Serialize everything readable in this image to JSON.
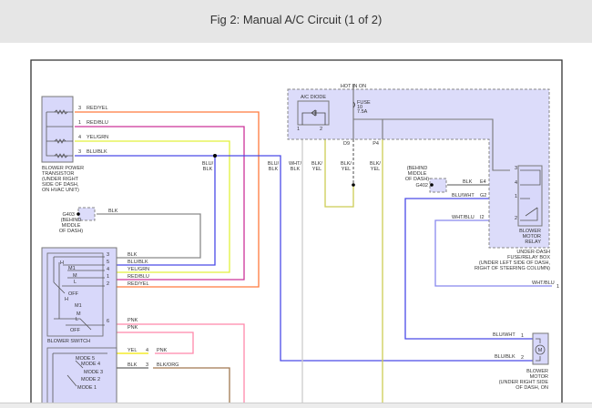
{
  "header": {
    "title": "Fig 2: Manual A/C Circuit (1 of 2)"
  },
  "colors": {
    "red_yel": "#ff7a3d",
    "red_blu": "#cc3399",
    "yel_grn": "#e2f03c",
    "blu": "#4a4ae8",
    "blk": "#8a8a8a",
    "wht": "#cccccc",
    "blk_yel": "#cccc55",
    "pnk": "#ff88aa",
    "brn": "#a07850",
    "yel": "#f2e600"
  },
  "transistor": {
    "label": [
      "BLOWER POWER",
      "TRANSISTOR",
      "(UNDER RIGHT",
      "SIDE OF DASH,",
      "ON HVAC UNIT)"
    ],
    "pins": [
      {
        "n": "3",
        "wire": "RED/YEL"
      },
      {
        "n": "1",
        "wire": "RED/BLU"
      },
      {
        "n": "4",
        "wire": "YEL/GRN"
      },
      {
        "n": "3",
        "wire": "BLU/BLK"
      }
    ]
  },
  "g403": {
    "label": [
      "G403",
      "(BEHIND",
      "MIDDLE",
      "OF DASH)"
    ],
    "wire": "BLK"
  },
  "vertical_labels": [
    [
      "BLU/",
      "BLK"
    ],
    [
      "BLU/",
      "BLK"
    ],
    [
      "WHT/",
      "BLK"
    ],
    [
      "BLK/",
      "YEL"
    ],
    [
      "BLK/",
      "YEL"
    ],
    [
      "BLK/",
      "YEL"
    ]
  ],
  "fusebox": {
    "hot": "HOT IN ON",
    "fuse": [
      "FUSE",
      "10",
      "7.5A"
    ],
    "diode": "A/C DIODE",
    "diode_pins": [
      "1",
      "2"
    ],
    "d9": "D9",
    "p4": "P4",
    "label": [
      "UNDER-DASH",
      "FUSE/RELAY BOX",
      "(UNDER LEFT SIDE OF DASH,",
      "RIGHT OF STEERING COLUMN)"
    ]
  },
  "g402": {
    "label": [
      "(BEHIND",
      "MIDDLE",
      "OF DASH)",
      "G402"
    ],
    "wire": "BLK",
    "pin": "E4"
  },
  "relay": {
    "label": [
      "BLOWER",
      "MOTOR",
      "RELAY"
    ],
    "pins": [
      "3",
      "4",
      "1",
      "2"
    ],
    "wires": [
      {
        "wire": "BLU/WHT",
        "pin": "G2"
      },
      {
        "wire": "WHT/BLU",
        "pin": "I2"
      }
    ]
  },
  "wht_blu_out": {
    "wire": "WHT/BLU",
    "pin": "1"
  },
  "switch": {
    "label": "BLOWER SWITCH",
    "positions": [
      "H",
      "M1",
      "M",
      "L",
      "OFF",
      "H",
      "M1",
      "M",
      "L",
      "OFF"
    ],
    "pins": [
      {
        "n": "3",
        "wire": "BLK"
      },
      {
        "n": "5",
        "wire": "BLU/BLK"
      },
      {
        "n": "4",
        "wire": "YEL/GRN"
      },
      {
        "n": "1",
        "wire": "RED/BLU"
      },
      {
        "n": "2",
        "wire": "RED/YEL"
      },
      {
        "n": "6",
        "wire": "PNK"
      }
    ],
    "pnk2": "PNK"
  },
  "mode": {
    "positions": [
      "MODE 5",
      "MODE 4",
      "MODE 3",
      "MODE 2",
      "MODE 1"
    ],
    "conn": [
      {
        "left": "YEL",
        "n": "4",
        "right": "PNK"
      },
      {
        "left": "BLK",
        "n": "3",
        "right": "BLK/ORG"
      }
    ]
  },
  "motor": {
    "symbol": "M",
    "label": [
      "BLOWER",
      "MOTOR",
      "(UNDER RIGHT SIDE",
      "OF DASH, ON"
    ],
    "pins": [
      {
        "n": "1",
        "wire": "BLU/WHT"
      },
      {
        "n": "2",
        "wire": "BLU/BLK"
      }
    ]
  }
}
